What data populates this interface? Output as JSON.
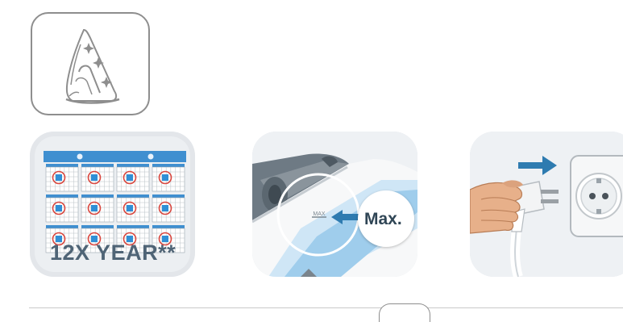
{
  "icons": {
    "top": "iron-self-clean-icon",
    "calendar": "calendar-icon",
    "max": "water-tank-max-icon",
    "unplug": "unplug-icon"
  },
  "calendar_tile": {
    "label": "12X YEAR**",
    "months": 12
  },
  "max_tile": {
    "bubble_label": "Max.",
    "mark_label": "MAX"
  },
  "colors": {
    "label_text": "#4f6476",
    "arrow_blue": "#2e7bb0",
    "calendar_red": "#d9463e",
    "calendar_blue": "#2f8fd6",
    "border_gray": "#8e8e8e"
  }
}
